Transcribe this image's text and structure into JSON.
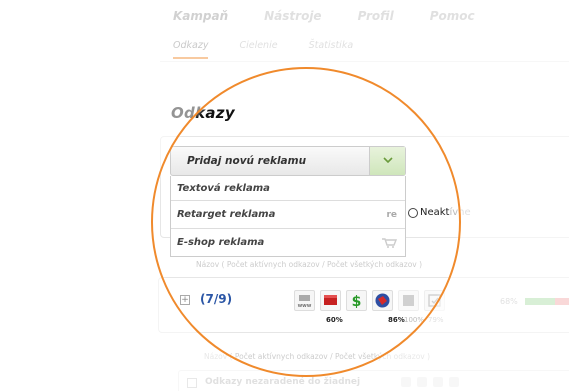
{
  "nav": {
    "main_tabs": [
      "Kampaň",
      "Nástroje",
      "Profil",
      "Pomoc"
    ],
    "sub_tabs": [
      "Odkazy",
      "Cielenie",
      "Štatistika"
    ]
  },
  "page": {
    "title": "Odkazy"
  },
  "dropdown": {
    "button_label": "Pridaj novú reklamu",
    "items": [
      {
        "label": "Textová reklama",
        "tag": ""
      },
      {
        "label": "Retarget reklama",
        "tag": "re"
      },
      {
        "label": "E-shop reklama",
        "tag": ""
      }
    ]
  },
  "status": {
    "radio_label": "Neakt",
    "faded_suffix": "ívne"
  },
  "hints": {
    "hint1": "Názov ( Počet aktívnych odkazov / Počet všetkých odkazov )",
    "hint2": "Názov ( Počet aktívnych odkazov / Počet všetkých odkazov )"
  },
  "group": {
    "count": "(7/9)",
    "icons": [
      {
        "name": "www-icon",
        "pct": ""
      },
      {
        "name": "flag-icon",
        "pct": "60%"
      },
      {
        "name": "dollar-icon",
        "pct": ""
      },
      {
        "name": "shopping-icon",
        "pct": "86%"
      },
      {
        "name": "media-icon",
        "pct": "100%"
      },
      {
        "name": "clock-icon",
        "pct": "79%"
      }
    ],
    "progress_label": "68%",
    "progress_value": 0.68
  },
  "unassigned": {
    "label": "Odkazy nezaradené do žiadnej"
  },
  "colors": {
    "accent": "#f08a2c",
    "link": "#2b56a6",
    "green": "#6a9b3c"
  }
}
